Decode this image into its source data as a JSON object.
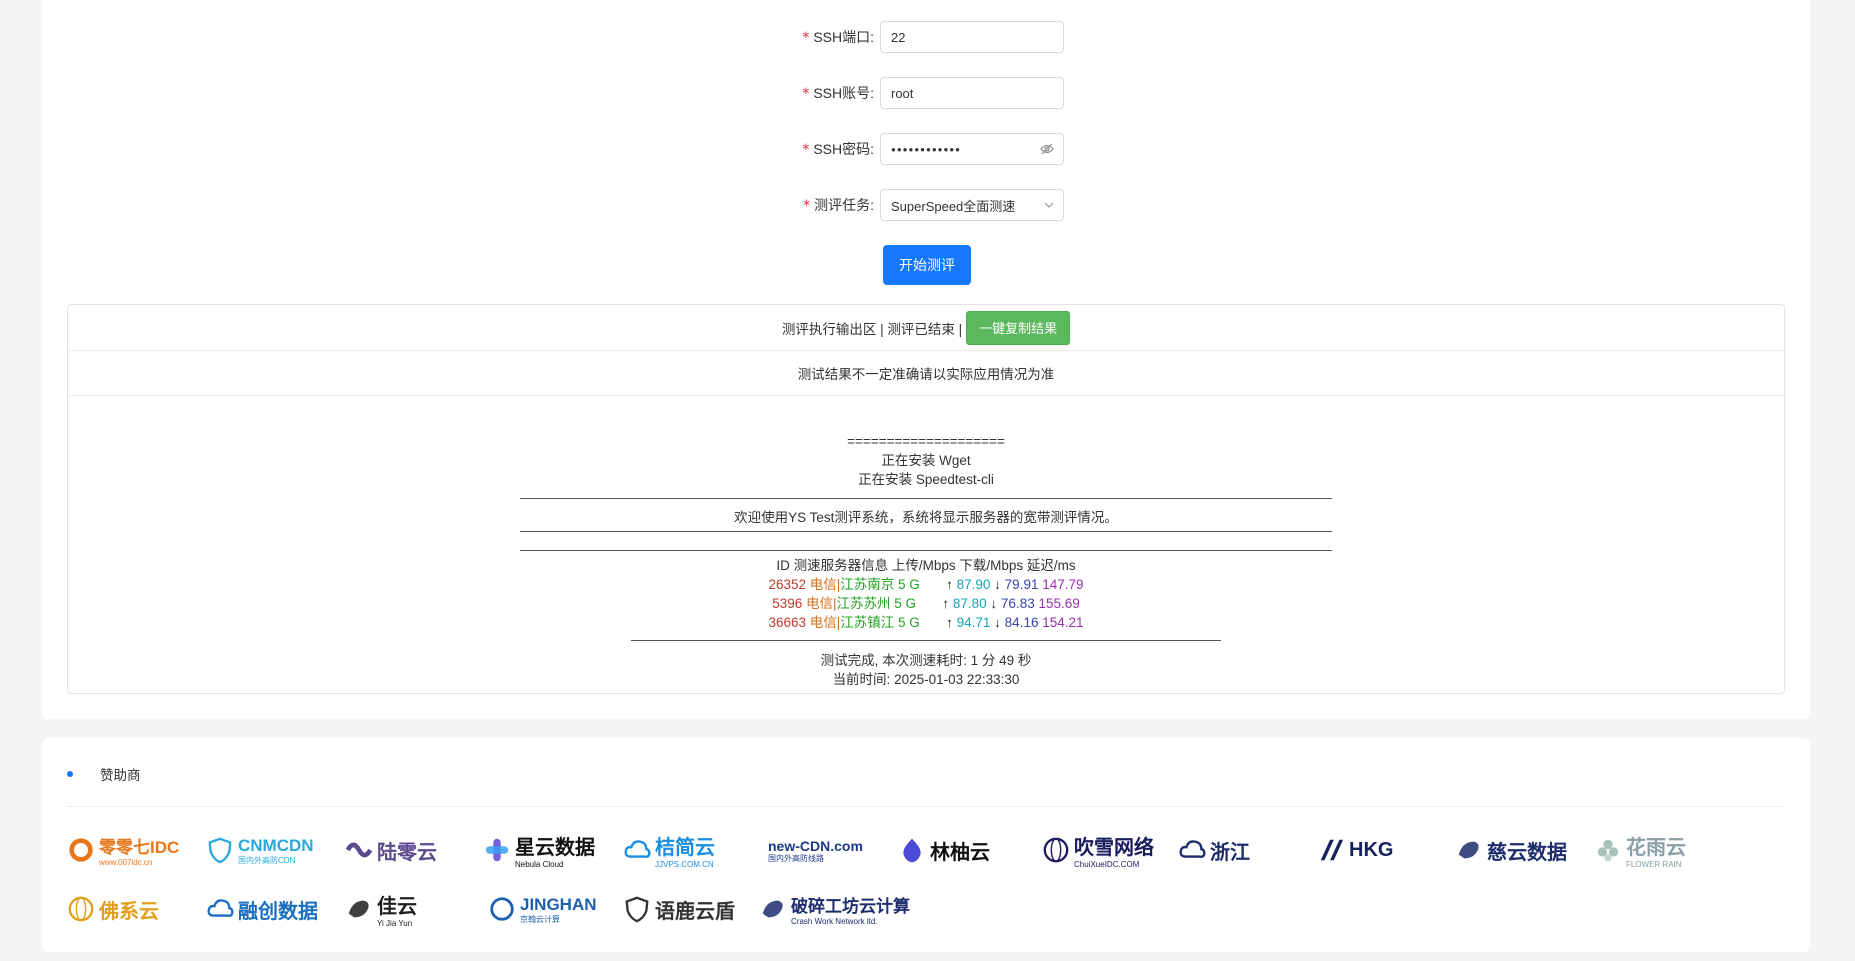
{
  "form": {
    "port_label": "SSH端口:",
    "port_value": "22",
    "user_label": "SSH账号:",
    "user_value": "root",
    "pass_label": "SSH密码:",
    "pass_value": "●●●●●●●●●●●●",
    "task_label": "测评任务:",
    "task_value": "SuperSpeed全面测速",
    "required_mark": "*",
    "start_button": "开始测评"
  },
  "output": {
    "header_text": "测评执行输出区 | 测评已结束 |",
    "copy_button": "一键复制结果",
    "notice": "测试结果不一定准确请以实际应用情况为准",
    "separator": "====================",
    "install_wget": "正在安装 Wget",
    "install_speedtest": "正在安装 Speedtest-cli",
    "welcome": "欢迎使用YS Test测评系统，系统将显示服务器的宽带测评情况。",
    "table_header": "ID 测速服务器信息 上传/Mbps 下载/Mbps 延迟/ms",
    "rows": [
      {
        "id": "26352",
        "isp": "电信|",
        "loc": "江苏南京 5 G",
        "up": "87.90",
        "down": "79.91",
        "lat": "147.79"
      },
      {
        "id": "5396",
        "isp": "电信|",
        "loc": "江苏苏州 5 G",
        "up": "87.80",
        "down": "76.83",
        "lat": "155.69"
      },
      {
        "id": "36663",
        "isp": "电信|",
        "loc": "江苏镇江 5 G",
        "up": "94.71",
        "down": "84.16",
        "lat": "154.21"
      }
    ],
    "up_arrow": "↑",
    "down_arrow": "↓",
    "done": "测试完成, 本次测速耗时: 1 分 49 秒",
    "current_time": "当前时间: 2025-01-03 22:33:30"
  },
  "sponsors": {
    "title": "赞助商",
    "logos": [
      {
        "text": "零零七IDC",
        "sub": "www.007idc.cn",
        "color": "#e8771c"
      },
      {
        "text": "CNMCDN",
        "sub": "国内外高防CDN",
        "color": "#2aa8e0"
      },
      {
        "text": "陆零云",
        "sub": "",
        "color": "#5b4a8f"
      },
      {
        "text": "星云数据",
        "sub": "Nebula Cloud",
        "color": "#111111"
      },
      {
        "text": "桔简云",
        "sub": "JJVPS.COM.CN",
        "color": "#1a8fe0"
      },
      {
        "text": "new-CDN.com",
        "sub": "国内外高防线路",
        "color": "#1d3a8a"
      },
      {
        "text": "林柚云",
        "sub": "",
        "color": "#111111"
      },
      {
        "text": "吹雪网络",
        "sub": "ChuiXueIDC.COM",
        "color": "#1b1b60"
      },
      {
        "text": "浙江",
        "sub": "",
        "color": "#1d2d6b"
      },
      {
        "text": "HKG",
        "sub": "",
        "color": "#16235c"
      },
      {
        "text": "慈云数据",
        "sub": "",
        "color": "#1d2d6b"
      },
      {
        "text": "花雨云",
        "sub": "FLOWER RAIN",
        "color": "#8aa0a8"
      },
      {
        "text": "佛系云",
        "sub": "",
        "color": "#e0a01c"
      },
      {
        "text": "融创数据",
        "sub": "",
        "color": "#1a6fc0"
      },
      {
        "text": "佳云",
        "sub": "Yi Jia Yun",
        "color": "#1d1d1d"
      },
      {
        "text": "JINGHAN",
        "sub": "京翰云计算",
        "color": "#1d5fb0"
      },
      {
        "text": "语鹿云盾",
        "sub": "",
        "color": "#333333"
      },
      {
        "text": "破碎工坊云计算",
        "sub": "Crash Work Network ltd.",
        "color": "#1d2d6b"
      }
    ]
  }
}
